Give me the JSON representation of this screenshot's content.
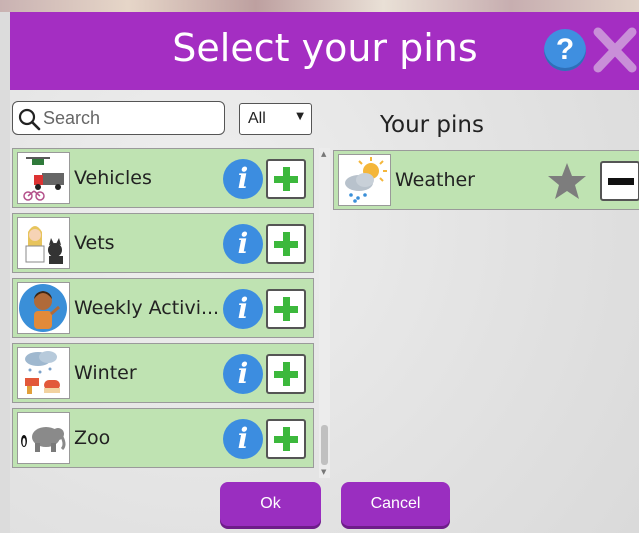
{
  "dialog": {
    "title": "Select your pins",
    "help_label": "?",
    "close_icon": "close-icon"
  },
  "search": {
    "placeholder": "Search"
  },
  "filter": {
    "selected": "All"
  },
  "your_pins_heading": "Your pins",
  "available": [
    {
      "label": "Vehicles",
      "icon": "vehicles-thumbnail"
    },
    {
      "label": "Vets",
      "icon": "vets-thumbnail"
    },
    {
      "label": "Weekly Activi...",
      "icon": "weekly-activities-thumbnail"
    },
    {
      "label": "Winter",
      "icon": "winter-thumbnail"
    },
    {
      "label": "Zoo",
      "icon": "zoo-thumbnail"
    }
  ],
  "pinned": [
    {
      "label": "Weather",
      "icon": "weather-thumbnail"
    }
  ],
  "info_label": "i",
  "buttons": {
    "ok": "Ok",
    "cancel": "Cancel"
  },
  "colors": {
    "titlebar": "#a42ec2",
    "row_bg": "#bfe3b2",
    "info_blue": "#3c8de0",
    "add_green": "#3cb83c",
    "button_purple": "#9a2ec0"
  }
}
